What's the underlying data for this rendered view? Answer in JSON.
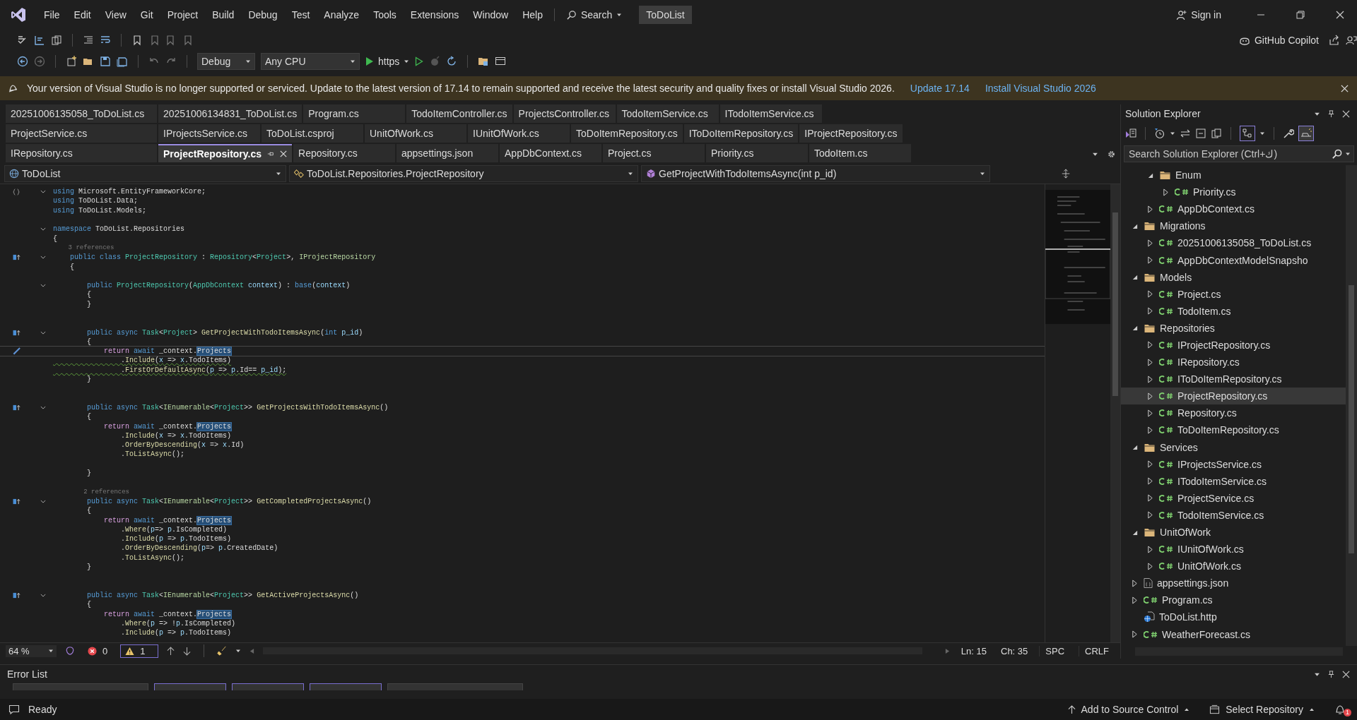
{
  "menu": {
    "items": [
      "File",
      "Edit",
      "View",
      "Git",
      "Project",
      "Build",
      "Debug",
      "Test",
      "Analyze",
      "Tools",
      "Extensions",
      "Window",
      "Help"
    ],
    "search": "Search",
    "solution_title": "ToDoList",
    "sign_in": "Sign in"
  },
  "toolbar": {
    "configuration": "Debug",
    "platform": "Any CPU",
    "run_target": "https",
    "copilot": "GitHub Copilot"
  },
  "info_bar": {
    "message": "Your version of Visual Studio is no longer supported or serviced. Update to the latest version of 17.14 to remain supported and receive the latest security and quality fixes or install Visual Studio 2026.",
    "links": [
      "Update 17.14",
      "Install Visual Studio 2026"
    ]
  },
  "tab_rows": [
    [
      {
        "label": "20251006135058_ToDoList.cs",
        "selected": false
      },
      {
        "label": "20251006134831_ToDoList.cs",
        "selected": false
      },
      {
        "label": "Program.cs",
        "selected": false
      },
      {
        "label": "TodoItemController.cs",
        "selected": false
      },
      {
        "label": "ProjectsController.cs",
        "selected": false
      },
      {
        "label": "TodoItemService.cs",
        "selected": false
      },
      {
        "label": "ITodoItemService.cs",
        "selected": false
      }
    ],
    [
      {
        "label": "ProjectService.cs",
        "selected": false
      },
      {
        "label": "IProjectsService.cs",
        "selected": false
      },
      {
        "label": "ToDoList.csproj",
        "selected": false
      },
      {
        "label": "UnitOfWork.cs",
        "selected": false
      },
      {
        "label": "IUnitOfWork.cs",
        "selected": false
      },
      {
        "label": "ToDoItemRepository.cs",
        "selected": false
      },
      {
        "label": "IToDoItemRepository.cs",
        "selected": false
      },
      {
        "label": "IProjectRepository.cs",
        "selected": false
      }
    ],
    [
      {
        "label": "IRepository.cs",
        "selected": false
      },
      {
        "label": "ProjectRepository.cs",
        "selected": true
      },
      {
        "label": "Repository.cs",
        "selected": false
      },
      {
        "label": "appsettings.json",
        "selected": false
      },
      {
        "label": "AppDbContext.cs",
        "selected": false
      },
      {
        "label": "Project.cs",
        "selected": false
      },
      {
        "label": "Priority.cs",
        "selected": false
      },
      {
        "label": "TodoItem.cs",
        "selected": false
      }
    ]
  ],
  "nav_bar": {
    "project": "ToDoList",
    "type": "ToDoList.Repositories.ProjectRepository",
    "member": "GetProjectWithTodoItemsAsync(int p_id)"
  },
  "code": [
    {
      "kind": "code",
      "fold": true,
      "usings_marker": true,
      "tokens": [
        {
          "kind": "kw",
          "text": "using"
        },
        {
          "kind": "tx",
          "text": " Microsoft.EntityFrameworkCore;"
        }
      ]
    },
    {
      "kind": "code",
      "tokens": [
        {
          "kind": "kw",
          "text": "using"
        },
        {
          "kind": "tx",
          "text": " ToDoList.Data;"
        }
      ]
    },
    {
      "kind": "code",
      "tokens": [
        {
          "kind": "kw",
          "text": "using"
        },
        {
          "kind": "tx",
          "text": " ToDoList.Models;"
        }
      ]
    },
    {
      "kind": "blank"
    },
    {
      "kind": "code",
      "fold": true,
      "tokens": [
        {
          "kind": "kw",
          "text": "namespace"
        },
        {
          "kind": "tx",
          "text": " ToDoList.Repositories"
        }
      ]
    },
    {
      "kind": "code",
      "tokens": [
        {
          "kind": "tx",
          "text": "{"
        }
      ]
    },
    {
      "kind": "lens",
      "text": "    3 references"
    },
    {
      "kind": "code",
      "fold": true,
      "implementations": true,
      "tokens": [
        {
          "kind": "kw",
          "text": "    public class "
        },
        {
          "kind": "ty",
          "text": "ProjectRepository"
        },
        {
          "kind": "tx",
          "text": " : "
        },
        {
          "kind": "ty",
          "text": "Repository"
        },
        {
          "kind": "tx",
          "text": "<"
        },
        {
          "kind": "ty",
          "text": "Project"
        },
        {
          "kind": "tx",
          "text": ">, "
        },
        {
          "kind": "if",
          "text": "IProjectRepository"
        }
      ]
    },
    {
      "kind": "code",
      "tokens": [
        {
          "kind": "tx",
          "text": "    {"
        }
      ]
    },
    {
      "kind": "blank"
    },
    {
      "kind": "code",
      "fold": true,
      "tokens": [
        {
          "kind": "kw",
          "text": "        public "
        },
        {
          "kind": "ty",
          "text": "ProjectRepository"
        },
        {
          "kind": "tx",
          "text": "("
        },
        {
          "kind": "ty",
          "text": "AppDbContext"
        },
        {
          "kind": "pm",
          "text": " context"
        },
        {
          "kind": "tx",
          "text": ") : "
        },
        {
          "kind": "kw",
          "text": "base"
        },
        {
          "kind": "tx",
          "text": "("
        },
        {
          "kind": "pm",
          "text": "context"
        },
        {
          "kind": "tx",
          "text": ")"
        }
      ]
    },
    {
      "kind": "code",
      "tokens": [
        {
          "kind": "tx",
          "text": "        {"
        }
      ]
    },
    {
      "kind": "code",
      "tokens": [
        {
          "kind": "tx",
          "text": "        }"
        }
      ]
    },
    {
      "kind": "blank"
    },
    {
      "kind": "blank"
    },
    {
      "kind": "code",
      "fold": true,
      "implementations": true,
      "tokens": [
        {
          "kind": "kw",
          "text": "        public async "
        },
        {
          "kind": "ty",
          "text": "Task"
        },
        {
          "kind": "tx",
          "text": "<"
        },
        {
          "kind": "ty",
          "text": "Project"
        },
        {
          "kind": "tx",
          "text": "> "
        },
        {
          "kind": "fn",
          "text": "GetProjectWithTodoItemsAsync"
        },
        {
          "kind": "tx",
          "text": "("
        },
        {
          "kind": "kw",
          "text": "int"
        },
        {
          "kind": "pm",
          "text": " p_id"
        },
        {
          "kind": "tx",
          "text": ")"
        }
      ]
    },
    {
      "kind": "code",
      "tokens": [
        {
          "kind": "tx",
          "text": "        {"
        }
      ]
    },
    {
      "kind": "code",
      "current": true,
      "quick_actions": true,
      "tokens": [
        {
          "kind": "ctl",
          "text": "            return "
        },
        {
          "kind": "kw",
          "text": "await "
        },
        {
          "kind": "tx",
          "text": "_context."
        },
        {
          "kind": "hl",
          "text": "Projects"
        }
      ]
    },
    {
      "kind": "code",
      "warning": true,
      "tokens": [
        {
          "kind": "tx",
          "text": "                ."
        },
        {
          "kind": "fn",
          "text": "Include"
        },
        {
          "kind": "tx",
          "text": "("
        },
        {
          "kind": "pm",
          "text": "x"
        },
        {
          "kind": "tx",
          "text": " => "
        },
        {
          "kind": "pm",
          "text": "x"
        },
        {
          "kind": "tx",
          "text": ".TodoItems)"
        }
      ]
    },
    {
      "kind": "code",
      "warning": true,
      "tokens": [
        {
          "kind": "tx",
          "text": "                ."
        },
        {
          "kind": "fn",
          "text": "FirstOrDefaultAsync"
        },
        {
          "kind": "tx",
          "text": "("
        },
        {
          "kind": "pm",
          "text": "p"
        },
        {
          "kind": "tx",
          "text": " => "
        },
        {
          "kind": "pm",
          "text": "p"
        },
        {
          "kind": "tx",
          "text": ".Id== "
        },
        {
          "kind": "pm",
          "text": "p_id"
        },
        {
          "kind": "tx",
          "text": ");"
        }
      ]
    },
    {
      "kind": "code",
      "tokens": [
        {
          "kind": "tx",
          "text": "        }"
        }
      ]
    },
    {
      "kind": "blank"
    },
    {
      "kind": "blank"
    },
    {
      "kind": "code",
      "fold": true,
      "implementations": true,
      "tokens": [
        {
          "kind": "kw",
          "text": "        public async "
        },
        {
          "kind": "ty",
          "text": "Task"
        },
        {
          "kind": "tx",
          "text": "<"
        },
        {
          "kind": "if",
          "text": "IEnumerable"
        },
        {
          "kind": "tx",
          "text": "<"
        },
        {
          "kind": "ty",
          "text": "Project"
        },
        {
          "kind": "tx",
          "text": ">> "
        },
        {
          "kind": "fn",
          "text": "GetProjectsWithTodoItemsAsync"
        },
        {
          "kind": "tx",
          "text": "()"
        }
      ]
    },
    {
      "kind": "code",
      "tokens": [
        {
          "kind": "tx",
          "text": "        {"
        }
      ]
    },
    {
      "kind": "code",
      "tokens": [
        {
          "kind": "ctl",
          "text": "            return "
        },
        {
          "kind": "kw",
          "text": "await "
        },
        {
          "kind": "tx",
          "text": "_context."
        },
        {
          "kind": "hl",
          "text": "Projects"
        }
      ]
    },
    {
      "kind": "code",
      "tokens": [
        {
          "kind": "tx",
          "text": "                ."
        },
        {
          "kind": "fn",
          "text": "Include"
        },
        {
          "kind": "tx",
          "text": "("
        },
        {
          "kind": "pm",
          "text": "x"
        },
        {
          "kind": "tx",
          "text": " => "
        },
        {
          "kind": "pm",
          "text": "x"
        },
        {
          "kind": "tx",
          "text": ".TodoItems)"
        }
      ]
    },
    {
      "kind": "code",
      "tokens": [
        {
          "kind": "tx",
          "text": "                ."
        },
        {
          "kind": "fn",
          "text": "OrderByDescending"
        },
        {
          "kind": "tx",
          "text": "("
        },
        {
          "kind": "pm",
          "text": "x"
        },
        {
          "kind": "tx",
          "text": " => "
        },
        {
          "kind": "pm",
          "text": "x"
        },
        {
          "kind": "tx",
          "text": ".Id)"
        }
      ]
    },
    {
      "kind": "code",
      "tokens": [
        {
          "kind": "tx",
          "text": "                ."
        },
        {
          "kind": "fn",
          "text": "ToListAsync"
        },
        {
          "kind": "tx",
          "text": "();"
        }
      ]
    },
    {
      "kind": "blank"
    },
    {
      "kind": "code",
      "tokens": [
        {
          "kind": "tx",
          "text": "        }"
        }
      ]
    },
    {
      "kind": "blank"
    },
    {
      "kind": "lens",
      "text": "        2 references"
    },
    {
      "kind": "code",
      "fold": true,
      "implementations": true,
      "tokens": [
        {
          "kind": "kw",
          "text": "        public async "
        },
        {
          "kind": "ty",
          "text": "Task"
        },
        {
          "kind": "tx",
          "text": "<"
        },
        {
          "kind": "if",
          "text": "IEnumerable"
        },
        {
          "kind": "tx",
          "text": "<"
        },
        {
          "kind": "ty",
          "text": "Project"
        },
        {
          "kind": "tx",
          "text": ">> "
        },
        {
          "kind": "fn",
          "text": "GetCompletedProjectsAsync"
        },
        {
          "kind": "tx",
          "text": "()"
        }
      ]
    },
    {
      "kind": "code",
      "tokens": [
        {
          "kind": "tx",
          "text": "        {"
        }
      ]
    },
    {
      "kind": "code",
      "tokens": [
        {
          "kind": "ctl",
          "text": "            return "
        },
        {
          "kind": "kw",
          "text": "await "
        },
        {
          "kind": "tx",
          "text": "_context."
        },
        {
          "kind": "hl",
          "text": "Projects"
        }
      ]
    },
    {
      "kind": "code",
      "tokens": [
        {
          "kind": "tx",
          "text": "                ."
        },
        {
          "kind": "fn",
          "text": "Where"
        },
        {
          "kind": "tx",
          "text": "("
        },
        {
          "kind": "pm",
          "text": "p"
        },
        {
          "kind": "tx",
          "text": "=> "
        },
        {
          "kind": "pm",
          "text": "p"
        },
        {
          "kind": "tx",
          "text": ".IsCompleted)"
        }
      ]
    },
    {
      "kind": "code",
      "tokens": [
        {
          "kind": "tx",
          "text": "                ."
        },
        {
          "kind": "fn",
          "text": "Include"
        },
        {
          "kind": "tx",
          "text": "("
        },
        {
          "kind": "pm",
          "text": "p"
        },
        {
          "kind": "tx",
          "text": " => "
        },
        {
          "kind": "pm",
          "text": "p"
        },
        {
          "kind": "tx",
          "text": ".TodoItems)"
        }
      ]
    },
    {
      "kind": "code",
      "tokens": [
        {
          "kind": "tx",
          "text": "                ."
        },
        {
          "kind": "fn",
          "text": "OrderByDescending"
        },
        {
          "kind": "tx",
          "text": "("
        },
        {
          "kind": "pm",
          "text": "p"
        },
        {
          "kind": "tx",
          "text": "=> "
        },
        {
          "kind": "pm",
          "text": "p"
        },
        {
          "kind": "tx",
          "text": ".CreatedDate)"
        }
      ]
    },
    {
      "kind": "code",
      "tokens": [
        {
          "kind": "tx",
          "text": "                ."
        },
        {
          "kind": "fn",
          "text": "ToListAsync"
        },
        {
          "kind": "tx",
          "text": "();"
        }
      ]
    },
    {
      "kind": "code",
      "tokens": [
        {
          "kind": "tx",
          "text": "        }"
        }
      ]
    },
    {
      "kind": "blank"
    },
    {
      "kind": "blank"
    },
    {
      "kind": "code",
      "fold": true,
      "implementations": true,
      "tokens": [
        {
          "kind": "kw",
          "text": "        public async "
        },
        {
          "kind": "ty",
          "text": "Task"
        },
        {
          "kind": "tx",
          "text": "<"
        },
        {
          "kind": "if",
          "text": "IEnumerable"
        },
        {
          "kind": "tx",
          "text": "<"
        },
        {
          "kind": "ty",
          "text": "Project"
        },
        {
          "kind": "tx",
          "text": ">> "
        },
        {
          "kind": "fn",
          "text": "GetActiveProjectsAsync"
        },
        {
          "kind": "tx",
          "text": "()"
        }
      ]
    },
    {
      "kind": "code",
      "tokens": [
        {
          "kind": "tx",
          "text": "        {"
        }
      ]
    },
    {
      "kind": "code",
      "tokens": [
        {
          "kind": "ctl",
          "text": "            return "
        },
        {
          "kind": "kw",
          "text": "await "
        },
        {
          "kind": "tx",
          "text": "_context."
        },
        {
          "kind": "hl",
          "text": "Projects"
        }
      ]
    },
    {
      "kind": "code",
      "tokens": [
        {
          "kind": "tx",
          "text": "                ."
        },
        {
          "kind": "fn",
          "text": "Where"
        },
        {
          "kind": "tx",
          "text": "("
        },
        {
          "kind": "pm",
          "text": "p"
        },
        {
          "kind": "tx",
          "text": " => !"
        },
        {
          "kind": "pm",
          "text": "p"
        },
        {
          "kind": "tx",
          "text": ".IsCompleted)"
        }
      ]
    },
    {
      "kind": "code",
      "tokens": [
        {
          "kind": "tx",
          "text": "                ."
        },
        {
          "kind": "fn",
          "text": "Include"
        },
        {
          "kind": "tx",
          "text": "("
        },
        {
          "kind": "pm",
          "text": "p"
        },
        {
          "kind": "tx",
          "text": " => "
        },
        {
          "kind": "pm",
          "text": "p"
        },
        {
          "kind": "tx",
          "text": ".TodoItems)"
        }
      ]
    }
  ],
  "editor_status": {
    "zoom": "64 %",
    "errors": "0",
    "warnings": "1",
    "line": "Ln: 15",
    "column": "Ch: 35",
    "whitespace": "SPC",
    "line_endings": "CRLF"
  },
  "explorer": {
    "title": "Solution Explorer",
    "search_placeholder": "Search Solution Explorer (Ctrl+ك)",
    "tree": [
      {
        "children": [
          {
            "name": "Enum",
            "kind": "folder",
            "expanded": true,
            "selected": false,
            "children": [
              {
                "name": "Priority.cs",
                "kind": "cs",
                "expanded": false,
                "selected": false
              }
            ]
          },
          {
            "name": "AppDbContext.cs",
            "kind": "cs",
            "expanded": false,
            "selected": false
          }
        ]
      },
      {
        "name": "Migrations",
        "kind": "folder",
        "expanded": true,
        "selected": false,
        "children": [
          {
            "name": "20251006135058_ToDoList.cs",
            "kind": "cs",
            "expanded": false,
            "selected": false
          },
          {
            "name": "AppDbContextModelSnapsho",
            "kind": "cs",
            "expanded": false,
            "selected": false
          }
        ]
      },
      {
        "name": "Models",
        "kind": "folder",
        "expanded": true,
        "selected": false,
        "children": [
          {
            "name": "Project.cs",
            "kind": "cs",
            "expanded": false,
            "selected": false
          },
          {
            "name": "TodoItem.cs",
            "kind": "cs",
            "expanded": false,
            "selected": false
          }
        ]
      },
      {
        "name": "Repositories",
        "kind": "folder",
        "expanded": true,
        "selected": false,
        "children": [
          {
            "name": "IProjectRepository.cs",
            "kind": "cs",
            "expanded": false,
            "selected": false
          },
          {
            "name": "IRepository.cs",
            "kind": "cs",
            "expanded": false,
            "selected": false
          },
          {
            "name": "IToDoItemRepository.cs",
            "kind": "cs",
            "expanded": false,
            "selected": false
          },
          {
            "name": "ProjectRepository.cs",
            "kind": "cs",
            "expanded": false,
            "selected": true
          },
          {
            "name": "Repository.cs",
            "kind": "cs",
            "expanded": false,
            "selected": false
          },
          {
            "name": "ToDoItemRepository.cs",
            "kind": "cs",
            "expanded": false,
            "selected": false
          }
        ]
      },
      {
        "name": "Services",
        "kind": "folder",
        "expanded": true,
        "selected": false,
        "children": [
          {
            "name": "IProjectsService.cs",
            "kind": "cs",
            "expanded": false,
            "selected": false
          },
          {
            "name": "ITodoItemService.cs",
            "kind": "cs",
            "expanded": false,
            "selected": false
          },
          {
            "name": "ProjectService.cs",
            "kind": "cs",
            "expanded": false,
            "selected": false
          },
          {
            "name": "TodoItemService.cs",
            "kind": "cs",
            "expanded": false,
            "selected": false
          }
        ]
      },
      {
        "name": "UnitOfWork",
        "kind": "folder",
        "expanded": true,
        "selected": false,
        "children": [
          {
            "name": "IUnitOfWork.cs",
            "kind": "cs",
            "expanded": false,
            "selected": false
          },
          {
            "name": "UnitOfWork.cs",
            "kind": "cs",
            "expanded": false,
            "selected": false
          }
        ]
      },
      {
        "name": "appsettings.json",
        "kind": "json",
        "expanded": false,
        "selected": false
      },
      {
        "name": "Program.cs",
        "kind": "cs",
        "expanded": false,
        "selected": false
      },
      {
        "name": "ToDoList.http",
        "kind": "http",
        "selected": false
      },
      {
        "name": "WeatherForecast.cs",
        "kind": "cs",
        "expanded": false,
        "selected": false
      }
    ]
  },
  "error_list": {
    "title": "Error List"
  },
  "status_bar": {
    "state": "Ready",
    "source_control": "Add to Source Control",
    "repository": "Select Repository",
    "notifications": "1"
  }
}
